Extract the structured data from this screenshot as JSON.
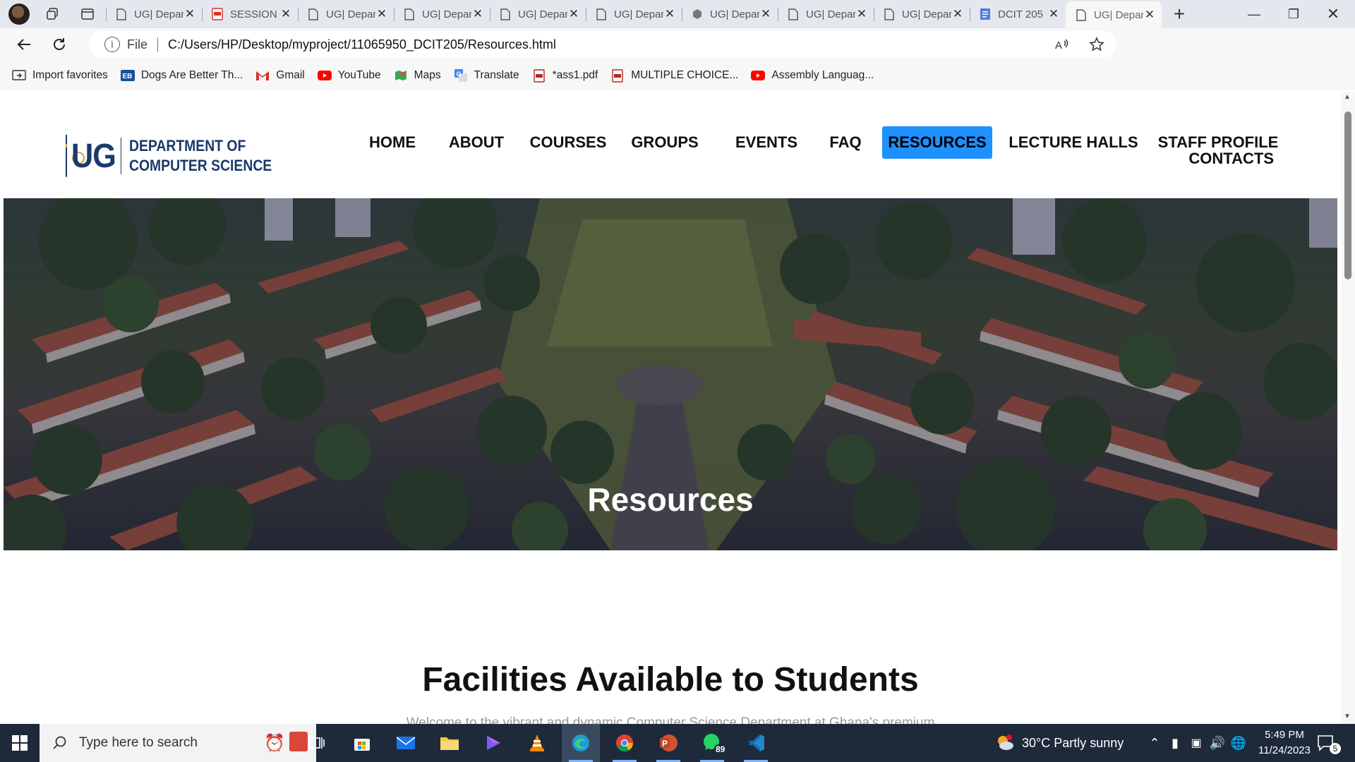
{
  "browser": {
    "tabs": [
      {
        "title": "UG| Department of Computer Science",
        "icon": "page-icon"
      },
      {
        "title": "SESSION",
        "icon": "pdf-icon"
      },
      {
        "title": "UG| Department of Computer Science",
        "icon": "page-icon"
      },
      {
        "title": "UG| Department of Computer Science",
        "icon": "page-icon"
      },
      {
        "title": "UG| Department of Computer Science",
        "icon": "page-icon"
      },
      {
        "title": "UG| Department of Computer Science",
        "icon": "page-icon"
      },
      {
        "title": "UG| Department of Computer Science",
        "icon": "cube-icon"
      },
      {
        "title": "UG| Department of Computer Science",
        "icon": "page-icon"
      },
      {
        "title": "UG| Department of Computer Science",
        "icon": "page-icon"
      },
      {
        "title": "DCIT 205",
        "icon": "doc-icon"
      },
      {
        "title": "UG| Department of Computer Science",
        "icon": "page-icon",
        "active": true
      }
    ],
    "address": {
      "scheme_label": "File",
      "url": "C:/Users/HP/Desktop/myproject/11065950_DCIT205/Resources.html"
    },
    "favorites": [
      {
        "label": "Import favorites",
        "icon": "import-icon"
      },
      {
        "label": "Dogs Are Better Th...",
        "icon": "eb-icon"
      },
      {
        "label": "Gmail",
        "icon": "gmail-icon"
      },
      {
        "label": "YouTube",
        "icon": "youtube-icon"
      },
      {
        "label": "Maps",
        "icon": "maps-icon"
      },
      {
        "label": "Translate",
        "icon": "translate-icon"
      },
      {
        "label": "*ass1.pdf",
        "icon": "pdf-icon"
      },
      {
        "label": "MULTIPLE CHOICE...",
        "icon": "pdf-icon"
      },
      {
        "label": "Assembly Languag...",
        "icon": "youtube-icon"
      }
    ]
  },
  "site": {
    "logo": {
      "ug": "UG",
      "dept_line1": "DEPARTMENT OF",
      "dept_line2": "COMPUTER SCIENCE"
    },
    "nav": [
      {
        "label": "HOME"
      },
      {
        "label": "ABOUT"
      },
      {
        "label": "COURSES"
      },
      {
        "label": "GROUPS"
      },
      {
        "label": "EVENTS"
      },
      {
        "label": "FAQ"
      },
      {
        "label": "RESOURCES",
        "active": true
      },
      {
        "label": "LECTURE HALLS"
      },
      {
        "label": "STAFF PROFILE"
      },
      {
        "label": "CONTACTS"
      }
    ],
    "hero_title": "Resources",
    "section_title": "Facilities Available to Students",
    "section_sub": "Welcome to the vibrant and dynamic Computer Science Department at Ghana's premium"
  },
  "taskbar": {
    "search_placeholder": "Type here to search",
    "weather": "30°C  Partly sunny",
    "time": "5:49 PM",
    "date": "11/24/2023",
    "whatsapp_badge": "89",
    "notification_count": "5"
  },
  "colors": {
    "brand_navy": "#1b3a6b",
    "nav_active": "#1e90ff",
    "taskbar": "#1e2a3a"
  }
}
